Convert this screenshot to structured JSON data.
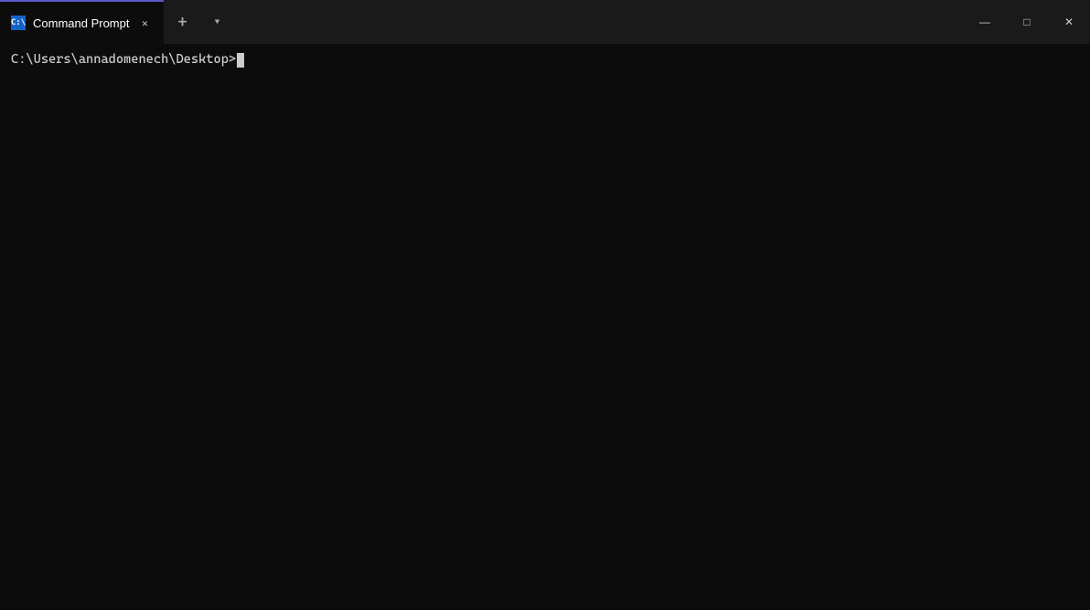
{
  "window": {
    "title": "Command Prompt"
  },
  "titlebar": {
    "tab_label": "Command Prompt",
    "new_tab_symbol": "+",
    "dropdown_symbol": "▾"
  },
  "window_controls": {
    "minimize_label": "—",
    "maximize_label": "□",
    "close_label": "✕"
  },
  "terminal": {
    "prompt": "C:\\Users\\annadomenech\\Desktop>"
  }
}
